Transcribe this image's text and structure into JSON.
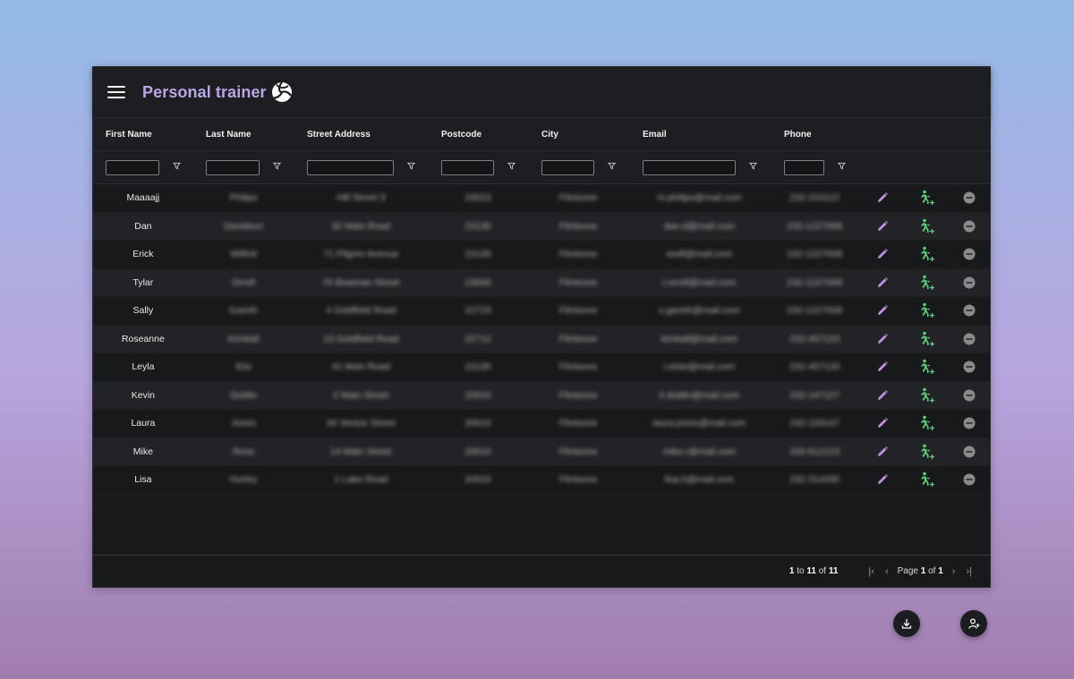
{
  "app": {
    "title": "Personal trainer"
  },
  "columns": [
    "First Name",
    "Last Name",
    "Street Address",
    "Postcode",
    "City",
    "Email",
    "Phone"
  ],
  "rows": [
    [
      "Maaaajj",
      "Philips",
      "Hill Street 3",
      "23023",
      "Flintsone",
      "m.philips@mail.com",
      "232-210122"
    ],
    [
      "Dan",
      "Davidson",
      "32 Main Road",
      "23130",
      "Flintsone",
      "dan.d@mail.com",
      "232-1227008"
    ],
    [
      "Erick",
      "Wilfrid",
      "71 Pilgrim Avenue",
      "23130",
      "Flintsone",
      "ewilf@mail.com",
      "232-1227008"
    ],
    [
      "Tylar",
      "Orrell",
      "70 Bowman Street",
      "23000",
      "Flintsone",
      "t.orrell@mail.com",
      "232-1227008"
    ],
    [
      "Sally",
      "Gareth",
      "4 Goldfield Road",
      "22723",
      "Flintsone",
      "s.gareth@mail.com",
      "232-1227008"
    ],
    [
      "Roseanne",
      "Kimball",
      "13 Goldfield Road",
      "22712",
      "Flintsone",
      "kimball@mail.com",
      "232-457133"
    ],
    [
      "Leyla",
      "Elsi",
      "41 Main Road",
      "23130",
      "Flintsone",
      "l.elsie@mail.com",
      "232-457133"
    ],
    [
      "Kevin",
      "Dublin",
      "2 Main Street",
      "20010",
      "Flintsone",
      "k.dublin@mail.com",
      "232-147127"
    ],
    [
      "Laura",
      "Jones",
      "34 Venice Street",
      "20010",
      "Flintsone",
      "laura.jones@mail.com",
      "232-133147"
    ],
    [
      "Mike",
      "Ross",
      "14 Main Street",
      "20010",
      "Flintsone",
      "mike.r@mail.com",
      "232-612123"
    ],
    [
      "Lisa",
      "Hurley",
      "1 Lake Road",
      "20010",
      "Flintsone",
      "lisa.h@mail.com",
      "232-314330"
    ]
  ],
  "footer": {
    "from": "1",
    "to_word": "to",
    "to": "11",
    "of_word": "of",
    "total": "11",
    "page_word": "Page",
    "page": "1",
    "page_of_word": "of",
    "pages": "1"
  },
  "icons": {
    "menu": "hamburger-icon",
    "logo": "volleyball-icon",
    "filter": "filter-icon",
    "edit": "pencil-icon",
    "training": "add-training-icon",
    "delete": "remove-circle-icon",
    "export": "download-icon",
    "add_customer": "add-person-icon"
  },
  "colors": {
    "title": "#b9a7e6",
    "edit": "#c48ee0",
    "training": "#5fcf7a",
    "delete": "#8a8a8a"
  }
}
